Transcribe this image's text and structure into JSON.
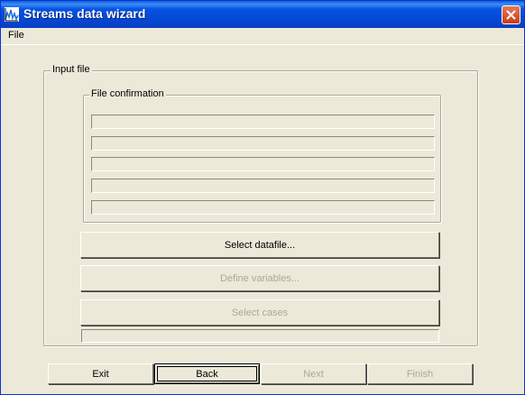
{
  "window": {
    "title": "Streams data wizard"
  },
  "menu": {
    "file_label": "File"
  },
  "input_group": {
    "legend": "Input file"
  },
  "confirm_group": {
    "legend": "File confirmation",
    "lines": [
      "",
      "",
      "",
      "",
      ""
    ]
  },
  "actions": {
    "select_datafile": "Select datafile...",
    "define_variables": "Define variables...",
    "select_cases": "Select cases",
    "progress_text": ""
  },
  "footer": {
    "exit": "Exit",
    "back": "Back",
    "next": "Next",
    "finish": "Finish"
  },
  "colors": {
    "titlebar": "#0554e3",
    "face": "#ece9d8",
    "close": "#c83c17",
    "disabled_text": "#aca899"
  },
  "icons": {
    "app": "chart-icon",
    "close": "close-icon"
  }
}
